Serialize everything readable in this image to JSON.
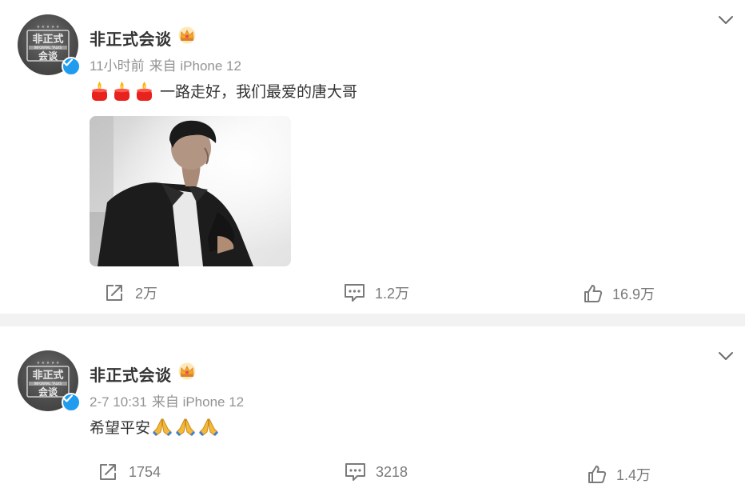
{
  "posts": [
    {
      "username": "非正式会谈",
      "time": "11小时前",
      "source": "来自 iPhone 12",
      "text": "一路走好，我们最爱的唐大哥",
      "leading_emojis": [
        "candle",
        "candle",
        "candle"
      ],
      "trailing_emojis": [],
      "has_image": true,
      "repost_count": "2万",
      "comment_count": "1.2万",
      "like_count": "16.9万"
    },
    {
      "username": "非正式会谈",
      "time": "2-7 10:31",
      "source": "来自 iPhone 12",
      "text": "希望平安",
      "leading_emojis": [],
      "trailing_emojis": [
        "pray",
        "pray",
        "pray"
      ],
      "has_image": false,
      "repost_count": "1754",
      "comment_count": "3218",
      "like_count": "1.4万"
    }
  ],
  "colors": {
    "verified": "#1f9bef",
    "crown": "#f5a623",
    "meta_text": "#939393",
    "separator": "#f2f2f2"
  },
  "icons": [
    "chevron-down-icon",
    "verified-icon",
    "crown-icon",
    "repost-icon",
    "comment-icon",
    "like-icon"
  ]
}
